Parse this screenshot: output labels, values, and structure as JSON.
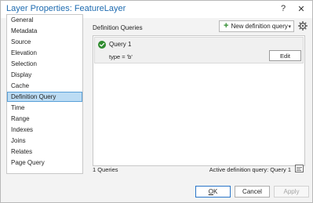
{
  "window": {
    "title": "Layer Properties: FeatureLayer",
    "help_label": "?",
    "close_label": "✕"
  },
  "sidebar": {
    "items": [
      {
        "label": "General"
      },
      {
        "label": "Metadata"
      },
      {
        "label": "Source"
      },
      {
        "label": "Elevation"
      },
      {
        "label": "Selection"
      },
      {
        "label": "Display"
      },
      {
        "label": "Cache"
      },
      {
        "label": "Definition Query"
      },
      {
        "label": "Time"
      },
      {
        "label": "Range"
      },
      {
        "label": "Indexes"
      },
      {
        "label": "Joins"
      },
      {
        "label": "Relates"
      },
      {
        "label": "Page Query"
      }
    ],
    "selected": "Definition Query"
  },
  "content": {
    "section_label": "Definition Queries",
    "new_query_label": "New definition query",
    "queries": [
      {
        "name": "Query 1",
        "expression": "type = 'b'",
        "edit_label": "Edit"
      }
    ],
    "count_label": "1 Queries",
    "active_label": "Active definition query: Query 1"
  },
  "footer": {
    "ok_rest": "K",
    "ok_mnemonic": "O",
    "cancel_label": "Cancel",
    "apply_label": "Apply"
  },
  "icons": {
    "plus": "plus-icon",
    "gear": "gear-icon",
    "check": "check-circle-icon",
    "active": "sql-icon"
  },
  "colors": {
    "title": "#1e6bb0",
    "selected_bg": "#bcdcf4",
    "selected_border": "#5aa0d8",
    "check": "#2e8b2e",
    "primary_border": "#2a75c9"
  }
}
